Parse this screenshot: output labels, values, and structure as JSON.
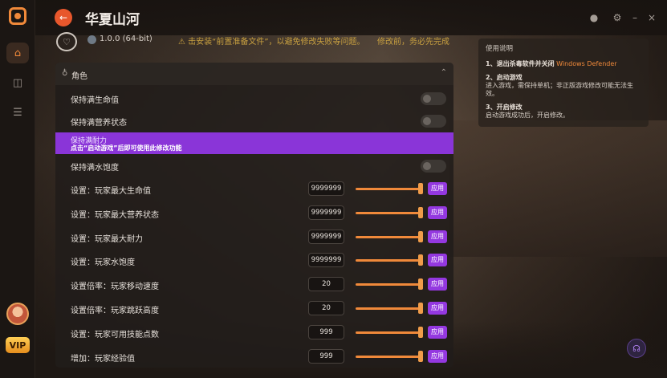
{
  "window": {
    "title": "华夏山河",
    "controls": {
      "record_icon": "record-icon",
      "settings_icon": "settings-icon",
      "minimize": "–",
      "close": "×"
    }
  },
  "sidebar": {
    "items": [
      {
        "name": "home",
        "icon": "⌂"
      },
      {
        "name": "games",
        "icon": "◫"
      },
      {
        "name": "library",
        "icon": "☰"
      }
    ],
    "vip_label": "VIP"
  },
  "game": {
    "version": "1.0.0 (64-bit)",
    "notice": "⚠ 击安装“前置准备文件”，以避免修改失败等问题。",
    "notice2": "修改前，务必先完成"
  },
  "info": {
    "heading": "使用说明",
    "steps": [
      {
        "title": "1、退出杀毒软件并关闭",
        "highlight": "Windows Defender",
        "body": ""
      },
      {
        "title": "2、启动游戏",
        "highlight": "",
        "body": "进入游戏，需保持单机；非正版游戏修改可能无法生效。"
      },
      {
        "title": "3、开启修改",
        "highlight": "",
        "body": "启动游戏成功后，开启修改。"
      }
    ]
  },
  "panel": {
    "section_label": "角色",
    "toggles": [
      {
        "label": "保持满生命值"
      },
      {
        "label": "保持满营养状态"
      }
    ],
    "highlighted": {
      "label": "保持满耐力",
      "hint": "点击“启动游戏”后即可使用此修改功能"
    },
    "toggle_after": {
      "label": "保持满水饱度"
    },
    "apply_label": "应用",
    "settings": [
      {
        "label": "设置：玩家最大生命值",
        "value": "9999999",
        "level": 1.0
      },
      {
        "label": "设置：玩家最大营养状态",
        "value": "9999999",
        "level": 1.0
      },
      {
        "label": "设置：玩家最大耐力",
        "value": "9999999",
        "level": 1.0
      },
      {
        "label": "设置：玩家水饱度",
        "value": "9999999",
        "level": 1.0
      },
      {
        "label": "设置倍率：玩家移动速度",
        "value": "20",
        "level": 1.0
      },
      {
        "label": "设置倍率：玩家跳跃高度",
        "value": "20",
        "level": 1.0
      },
      {
        "label": "设置：玩家可用技能点数",
        "value": "999",
        "level": 1.0
      },
      {
        "label": "增加：玩家经验值",
        "value": "999",
        "level": 1.0
      }
    ]
  },
  "colors": {
    "accent": "#f0893a",
    "purple": "#9438e0",
    "back": "#e8572c"
  }
}
